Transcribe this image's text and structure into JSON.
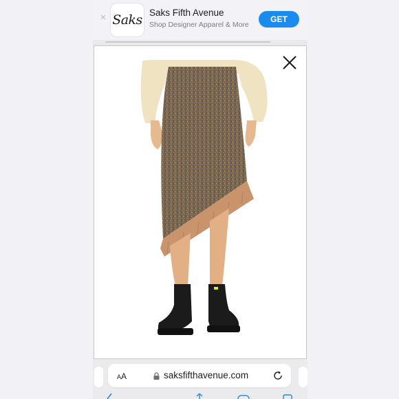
{
  "banner": {
    "app_icon_text": "Saks",
    "app_name": "Saks Fifth Avenue",
    "app_subtitle": "Shop Designer Apparel & More",
    "get_label": "GET",
    "close_glyph": "×"
  },
  "address_bar": {
    "text_size_label_small": "A",
    "text_size_label_large": "A",
    "url": "saksfifthavenue.com"
  },
  "modal": {
    "close_icon": "close-icon",
    "image": "product-photo-asymmetric-fringe-tweed-skirt"
  },
  "colors": {
    "accent": "#1a8cf0",
    "skirt": "#7a6a58",
    "fringe": "#c9946c",
    "sweater": "#efe3c2",
    "boots": "#1b1b1b"
  }
}
